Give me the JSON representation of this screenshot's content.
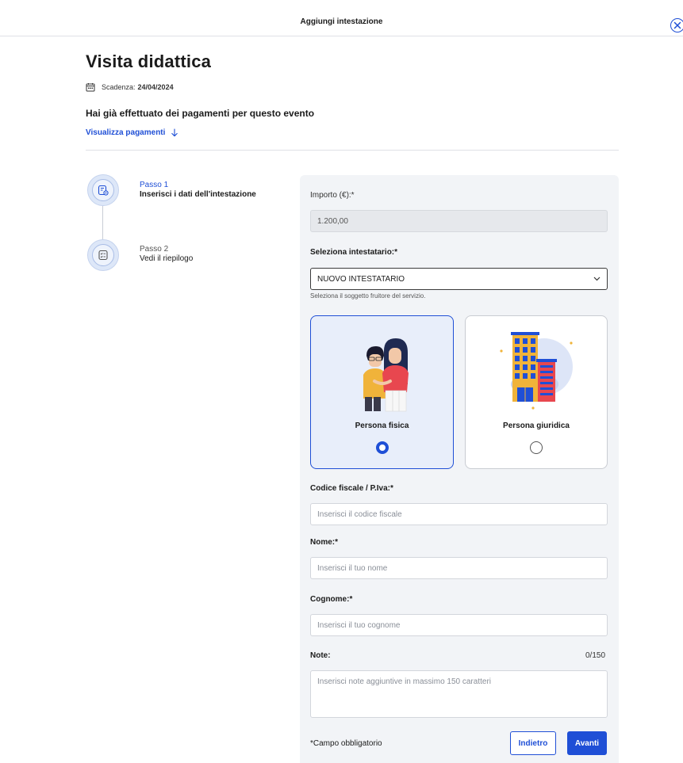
{
  "header": {
    "title": "Aggiungi intestazione"
  },
  "event": {
    "title": "Visita didattica",
    "deadline_label": "Scadenza:",
    "deadline_value": "24/04/2024",
    "payments_notice": "Hai già effettuato dei pagamenti per questo evento",
    "payments_link": "Visualizza pagamenti"
  },
  "steps": [
    {
      "number": "Passo 1",
      "title": "Inserisci i dati dell'intestazione",
      "active": true
    },
    {
      "number": "Passo 2",
      "title": "Vedi il riepilogo",
      "active": false
    }
  ],
  "form": {
    "amount_label": "Importo (€):*",
    "amount_value": "1.200,00",
    "holder_label": "Seleziona intestatario:*",
    "holder_value": "NUOVO INTESTATARIO",
    "holder_hint": "Seleziona il soggetto fruitore del servizio.",
    "holder_types": [
      {
        "label": "Persona fisica",
        "selected": true
      },
      {
        "label": "Persona giuridica",
        "selected": false
      }
    ],
    "tax_code_label": "Codice fiscale / P.Iva:*",
    "tax_code_placeholder": "Inserisci il codice fiscale",
    "name_label": "Nome:*",
    "name_placeholder": "Inserisci il tuo nome",
    "surname_label": "Cognome:*",
    "surname_placeholder": "Inserisci il tuo cognome",
    "notes_label": "Note:",
    "notes_counter": "0/150",
    "notes_placeholder": "Inserisci note aggiuntive in massimo 150 caratteri",
    "required_note": "*Campo obbligatorio",
    "back_label": "Indietro",
    "next_label": "Avanti"
  },
  "colors": {
    "primary": "#1f4fd6",
    "card_bg": "#f2f4f7",
    "selected_bg": "#e8eefa"
  }
}
